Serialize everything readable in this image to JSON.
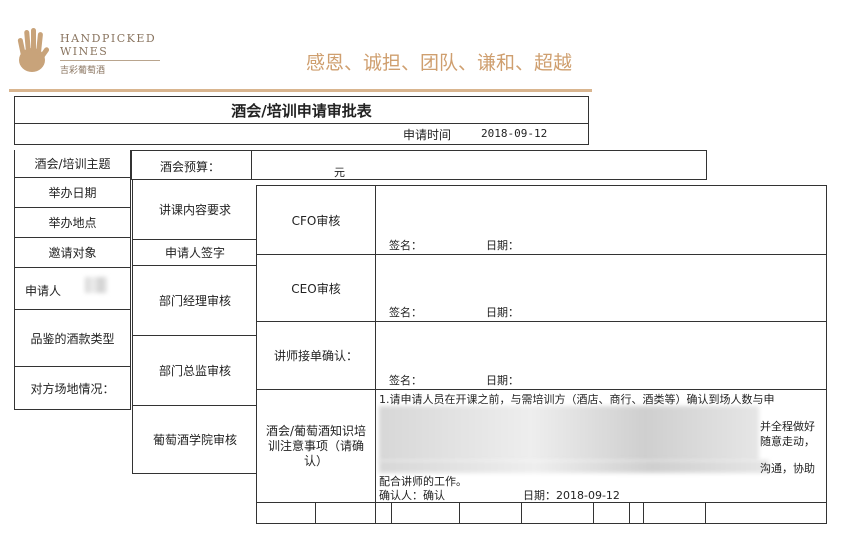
{
  "header": {
    "logo_line1": "HANDPICKED",
    "logo_line2": "WINES",
    "logo_cn": "吉彩葡萄酒",
    "slogan": "感恩、诚担、团队、谦和、超越",
    "accent_color": "#c8a37a",
    "rule_color": "#d9b58f"
  },
  "form": {
    "title": "酒会/培训申请审批表",
    "apply_time_label": "申请时间",
    "apply_time_value": "2018-09-12",
    "left_labels": [
      "酒会/培训主题",
      "举办日期",
      "举办地点",
      "邀请对象",
      "申请人",
      "品鉴的酒款类型",
      "对方场地情况："
    ],
    "budget_label": "酒会预算：",
    "budget_unit": "元",
    "mid_labels": [
      "讲课内容要求",
      "申请人签字",
      "部门经理审核",
      "部门总监审核",
      "葡萄酒学院审核"
    ]
  },
  "approval": {
    "rows": [
      {
        "label": "CFO审核",
        "sign": "签名：",
        "date": "日期："
      },
      {
        "label": "CEO审核",
        "sign": "签名：",
        "date": "日期："
      },
      {
        "label": "讲师接单确认：",
        "sign": "签名：",
        "date": "日期："
      }
    ],
    "notice_label": "酒会/葡萄酒知识培训注意事项（请确认）",
    "notice_line1": "1.请申请人员在开课之前，与需培训方（酒店、商行、酒类等）确认到场人数与申",
    "notice_right1": "并全程做好",
    "notice_right2": "随意走动，",
    "notice_line_last": "配合讲师的工作。",
    "notice_right3": "沟通，协助",
    "confirm_label": "确认人：确认",
    "confirm_date": "日期：2018-09-12"
  }
}
